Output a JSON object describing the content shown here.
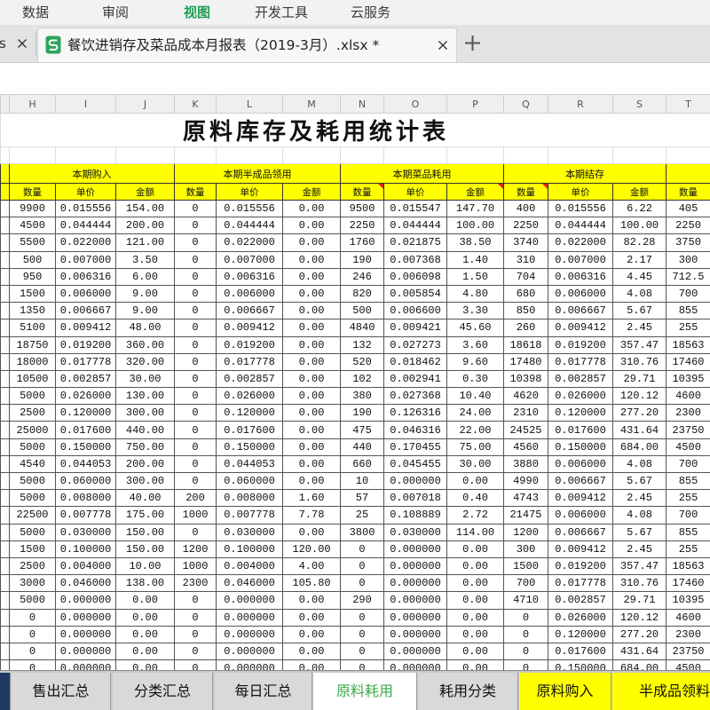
{
  "menu": {
    "items": [
      "数据",
      "审阅",
      "视图",
      "开发工具",
      "云服务"
    ],
    "active_index": 2
  },
  "document_tabs": {
    "previous_fragment": "s",
    "active_title": "餐饮进销存及菜品成本月报表（2019-3月）.xlsx *"
  },
  "icons": {
    "tab_close": "close-icon",
    "file": "spreadsheet-file-icon",
    "new_tab": "plus-icon"
  },
  "colors": {
    "accent_green": "#1f9d55",
    "header_yellow": "#ffff00",
    "comment_red": "#e02020",
    "navy_sheet_tab": "#1f3864",
    "active_sheet_text": "#3cab4a"
  },
  "sheet": {
    "columns": [
      "H",
      "I",
      "J",
      "K",
      "L",
      "M",
      "N",
      "O",
      "P",
      "Q",
      "R",
      "S",
      "T"
    ],
    "title": "原料库存及耗用统计表",
    "groups": [
      "本期购入",
      "本期半成品领用",
      "本期菜品耗用",
      "本期结存"
    ],
    "subheaders": [
      "数量",
      "单价",
      "金额",
      "数量",
      "单价",
      "金额",
      "数量",
      "单价",
      "金额",
      "数量",
      "单价",
      "金额",
      "数量"
    ],
    "rows": [
      [
        "9900",
        "0.015556",
        "154.00",
        "0",
        "0.015556",
        "0.00",
        "9500",
        "0.015547",
        "147.70",
        "400",
        "0.015556",
        "6.22",
        "405"
      ],
      [
        "4500",
        "0.044444",
        "200.00",
        "0",
        "0.044444",
        "0.00",
        "2250",
        "0.044444",
        "100.00",
        "2250",
        "0.044444",
        "100.00",
        "2250"
      ],
      [
        "5500",
        "0.022000",
        "121.00",
        "0",
        "0.022000",
        "0.00",
        "1760",
        "0.021875",
        "38.50",
        "3740",
        "0.022000",
        "82.28",
        "3750"
      ],
      [
        "500",
        "0.007000",
        "3.50",
        "0",
        "0.007000",
        "0.00",
        "190",
        "0.007368",
        "1.40",
        "310",
        "0.007000",
        "2.17",
        "300"
      ],
      [
        "950",
        "0.006316",
        "6.00",
        "0",
        "0.006316",
        "0.00",
        "246",
        "0.006098",
        "1.50",
        "704",
        "0.006316",
        "4.45",
        "712.5"
      ],
      [
        "1500",
        "0.006000",
        "9.00",
        "0",
        "0.006000",
        "0.00",
        "820",
        "0.005854",
        "4.80",
        "680",
        "0.006000",
        "4.08",
        "700"
      ],
      [
        "1350",
        "0.006667",
        "9.00",
        "0",
        "0.006667",
        "0.00",
        "500",
        "0.006600",
        "3.30",
        "850",
        "0.006667",
        "5.67",
        "855"
      ],
      [
        "5100",
        "0.009412",
        "48.00",
        "0",
        "0.009412",
        "0.00",
        "4840",
        "0.009421",
        "45.60",
        "260",
        "0.009412",
        "2.45",
        "255"
      ],
      [
        "18750",
        "0.019200",
        "360.00",
        "0",
        "0.019200",
        "0.00",
        "132",
        "0.027273",
        "3.60",
        "18618",
        "0.019200",
        "357.47",
        "18563"
      ],
      [
        "18000",
        "0.017778",
        "320.00",
        "0",
        "0.017778",
        "0.00",
        "520",
        "0.018462",
        "9.60",
        "17480",
        "0.017778",
        "310.76",
        "17460"
      ],
      [
        "10500",
        "0.002857",
        "30.00",
        "0",
        "0.002857",
        "0.00",
        "102",
        "0.002941",
        "0.30",
        "10398",
        "0.002857",
        "29.71",
        "10395"
      ],
      [
        "5000",
        "0.026000",
        "130.00",
        "0",
        "0.026000",
        "0.00",
        "380",
        "0.027368",
        "10.40",
        "4620",
        "0.026000",
        "120.12",
        "4600"
      ],
      [
        "2500",
        "0.120000",
        "300.00",
        "0",
        "0.120000",
        "0.00",
        "190",
        "0.126316",
        "24.00",
        "2310",
        "0.120000",
        "277.20",
        "2300"
      ],
      [
        "25000",
        "0.017600",
        "440.00",
        "0",
        "0.017600",
        "0.00",
        "475",
        "0.046316",
        "22.00",
        "24525",
        "0.017600",
        "431.64",
        "23750"
      ],
      [
        "5000",
        "0.150000",
        "750.00",
        "0",
        "0.150000",
        "0.00",
        "440",
        "0.170455",
        "75.00",
        "4560",
        "0.150000",
        "684.00",
        "4500"
      ],
      [
        "4540",
        "0.044053",
        "200.00",
        "0",
        "0.044053",
        "0.00",
        "660",
        "0.045455",
        "30.00",
        "3880",
        "0.006000",
        "4.08",
        "700"
      ],
      [
        "5000",
        "0.060000",
        "300.00",
        "0",
        "0.060000",
        "0.00",
        "10",
        "0.000000",
        "0.00",
        "4990",
        "0.006667",
        "5.67",
        "855"
      ],
      [
        "5000",
        "0.008000",
        "40.00",
        "200",
        "0.008000",
        "1.60",
        "57",
        "0.007018",
        "0.40",
        "4743",
        "0.009412",
        "2.45",
        "255"
      ],
      [
        "22500",
        "0.007778",
        "175.00",
        "1000",
        "0.007778",
        "7.78",
        "25",
        "0.108889",
        "2.72",
        "21475",
        "0.006000",
        "4.08",
        "700"
      ],
      [
        "5000",
        "0.030000",
        "150.00",
        "0",
        "0.030000",
        "0.00",
        "3800",
        "0.030000",
        "114.00",
        "1200",
        "0.006667",
        "5.67",
        "855"
      ],
      [
        "1500",
        "0.100000",
        "150.00",
        "1200",
        "0.100000",
        "120.00",
        "0",
        "0.000000",
        "0.00",
        "300",
        "0.009412",
        "2.45",
        "255"
      ],
      [
        "2500",
        "0.004000",
        "10.00",
        "1000",
        "0.004000",
        "4.00",
        "0",
        "0.000000",
        "0.00",
        "1500",
        "0.019200",
        "357.47",
        "18563"
      ],
      [
        "3000",
        "0.046000",
        "138.00",
        "2300",
        "0.046000",
        "105.80",
        "0",
        "0.000000",
        "0.00",
        "700",
        "0.017778",
        "310.76",
        "17460"
      ],
      [
        "5000",
        "0.000000",
        "0.00",
        "0",
        "0.000000",
        "0.00",
        "290",
        "0.000000",
        "0.00",
        "4710",
        "0.002857",
        "29.71",
        "10395"
      ],
      [
        "0",
        "0.000000",
        "0.00",
        "0",
        "0.000000",
        "0.00",
        "0",
        "0.000000",
        "0.00",
        "0",
        "0.026000",
        "120.12",
        "4600"
      ],
      [
        "0",
        "0.000000",
        "0.00",
        "0",
        "0.000000",
        "0.00",
        "0",
        "0.000000",
        "0.00",
        "0",
        "0.120000",
        "277.20",
        "2300"
      ],
      [
        "0",
        "0.000000",
        "0.00",
        "0",
        "0.000000",
        "0.00",
        "0",
        "0.000000",
        "0.00",
        "0",
        "0.017600",
        "431.64",
        "23750"
      ],
      [
        "0",
        "0.000000",
        "0.00",
        "0",
        "0.000000",
        "0.00",
        "0",
        "0.000000",
        "0.00",
        "0",
        "0.150000",
        "684.00",
        "4500"
      ]
    ]
  },
  "sheet_tabs": [
    {
      "label": "售出汇总"
    },
    {
      "label": "分类汇总"
    },
    {
      "label": "每日汇总"
    },
    {
      "label": "原料耗用",
      "active": true
    },
    {
      "label": "耗用分类"
    },
    {
      "label": "原料购入"
    },
    {
      "label": "半成品领料"
    }
  ]
}
